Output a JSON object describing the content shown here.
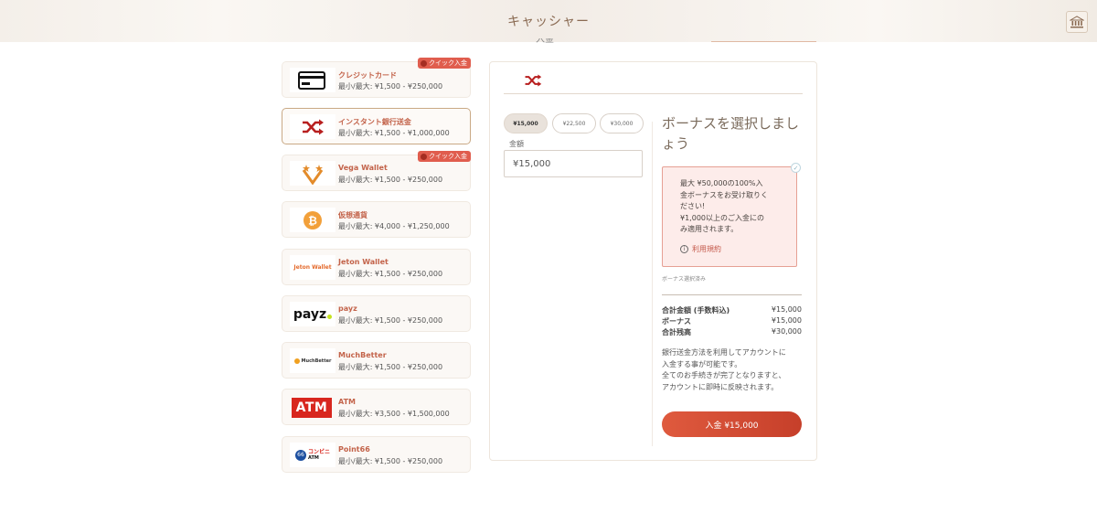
{
  "header": {
    "title": "キャッシャー",
    "bank_icon": "bank-icon",
    "peek_text": "入金"
  },
  "methods": [
    {
      "name": "クレジットカード",
      "range": "最小/最大: ¥1,500 - ¥250,000",
      "icon": "credit-card-icon",
      "quick": true
    },
    {
      "name": "インスタント銀行送金",
      "range": "最小/最大: ¥1,500 - ¥1,000,000",
      "icon": "shuffle-icon",
      "quick": false,
      "selected": true
    },
    {
      "name": "Vega Wallet",
      "range": "最小/最大: ¥1,500 - ¥250,000",
      "icon": "vega-wallet-icon",
      "quick": true
    },
    {
      "name": "仮想通貨",
      "range": "最小/最大: ¥4,000 - ¥1,250,000",
      "icon": "bitcoin-icon",
      "quick": false
    },
    {
      "name": "Jeton Wallet",
      "range": "最小/最大: ¥1,500 - ¥250,000",
      "icon": "jeton-icon",
      "logo_text": "Jeton Wallet",
      "quick": false
    },
    {
      "name": "payz",
      "range": "最小/最大: ¥1,500 - ¥250,000",
      "icon": "payz-icon",
      "logo_text": "payz",
      "quick": false
    },
    {
      "name": "MuchBetter",
      "range": "最小/最大: ¥1,500 - ¥250,000",
      "icon": "muchbetter-icon",
      "logo_text": "MuchBetter",
      "quick": false
    },
    {
      "name": "ATM",
      "range": "最小/最大: ¥3,500 - ¥1,500,000",
      "icon": "atm-icon",
      "logo_text": "ATM",
      "quick": false
    },
    {
      "name": "Point66",
      "range": "最小/最大: ¥1,500 - ¥250,000",
      "icon": "point66-icon",
      "logo_text": "コンビニ",
      "logo_sub": "ATM",
      "quick": false
    }
  ],
  "quick_badge": "クイック入金",
  "deposit": {
    "chips": [
      "¥15,000",
      "¥22,500",
      "¥30,000"
    ],
    "active_chip": 0,
    "amount_label": "金額",
    "amount_value": "¥15,000"
  },
  "bonus": {
    "title": "ボーナスを選択しましょう",
    "lines": [
      "最大 ¥50,000の100%入",
      "金ボーナスをお受け取りく",
      "ださい!",
      "¥1,000以上のご入金にの",
      "み適用されます。"
    ],
    "terms": "利用規約",
    "status": "ボーナス選択済み"
  },
  "summary": [
    {
      "label": "合計金額 (手数料込)",
      "value": "¥15,000"
    },
    {
      "label": "ボーナス",
      "value": "¥15,000"
    },
    {
      "label": "合計残高",
      "value": "¥30,000"
    }
  ],
  "description": [
    "銀行送金方法を利用してアカウントに",
    "入金する事が可能です。",
    "全てのお手続きが完了となりますと、",
    "アカウントに即時に反映されます。"
  ],
  "deposit_button": "入金 ¥15,000",
  "colors": {
    "accent": "#d24c35",
    "badge": "#e05d4e",
    "brand_text": "#c3634a"
  }
}
